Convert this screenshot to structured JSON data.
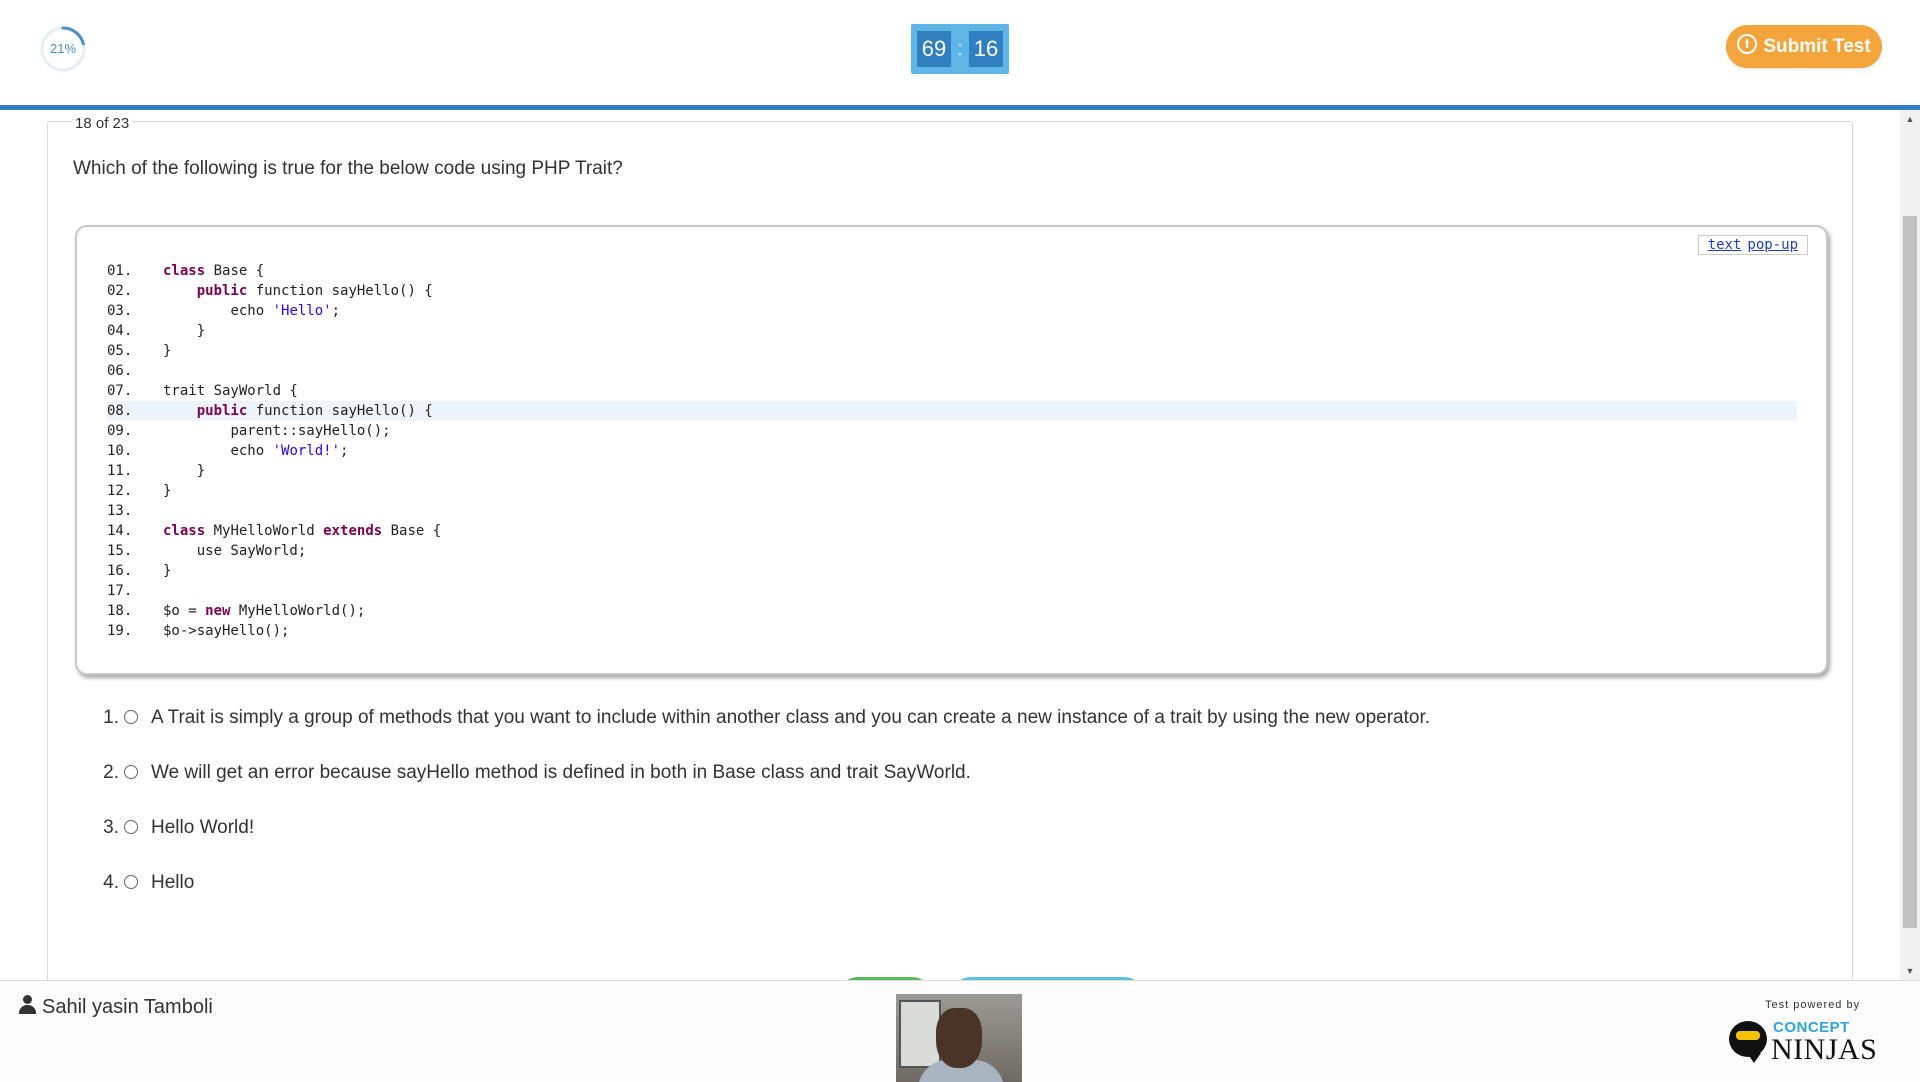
{
  "header": {
    "progress_label": "21%",
    "progress_value": 0.21,
    "timer_minutes": "69",
    "timer_separator": ":",
    "timer_seconds": "16",
    "submit_label": "Submit Test"
  },
  "question": {
    "counter": "18 of 23",
    "text": "Which of the following is true for the below code using PHP Trait?",
    "code_links": [
      "text",
      "pop-up"
    ],
    "code": [
      {
        "n": "01.",
        "indent": "",
        "tokens": [
          [
            "kw",
            "class"
          ],
          [
            "txt",
            " Base {"
          ]
        ]
      },
      {
        "n": "02.",
        "indent": "    ",
        "tokens": [
          [
            "kw",
            "public"
          ],
          [
            "txt",
            " function sayHello() {"
          ]
        ]
      },
      {
        "n": "03.",
        "indent": "        ",
        "tokens": [
          [
            "txt",
            "echo "
          ],
          [
            "str",
            "'Hello'"
          ],
          [
            "txt",
            ";"
          ]
        ]
      },
      {
        "n": "04.",
        "indent": "    ",
        "tokens": [
          [
            "txt",
            "}"
          ]
        ]
      },
      {
        "n": "05.",
        "indent": "",
        "tokens": [
          [
            "txt",
            "}"
          ]
        ]
      },
      {
        "n": "06.",
        "indent": "",
        "tokens": []
      },
      {
        "n": "07.",
        "indent": "",
        "tokens": [
          [
            "txt",
            "trait SayWorld {"
          ]
        ]
      },
      {
        "n": "08.",
        "indent": "    ",
        "tokens": [
          [
            "kw",
            "public"
          ],
          [
            "txt",
            " function sayHello() {"
          ]
        ],
        "highlight": true
      },
      {
        "n": "09.",
        "indent": "        ",
        "tokens": [
          [
            "txt",
            "parent::sayHello();"
          ]
        ]
      },
      {
        "n": "10.",
        "indent": "        ",
        "tokens": [
          [
            "txt",
            "echo "
          ],
          [
            "str",
            "'World!'"
          ],
          [
            "txt",
            ";"
          ]
        ]
      },
      {
        "n": "11.",
        "indent": "    ",
        "tokens": [
          [
            "txt",
            "}"
          ]
        ]
      },
      {
        "n": "12.",
        "indent": "",
        "tokens": [
          [
            "txt",
            "}"
          ]
        ]
      },
      {
        "n": "13.",
        "indent": "",
        "tokens": []
      },
      {
        "n": "14.",
        "indent": "",
        "tokens": [
          [
            "kw",
            "class"
          ],
          [
            "txt",
            " MyHelloWorld "
          ],
          [
            "kw",
            "extends"
          ],
          [
            "txt",
            " Base {"
          ]
        ]
      },
      {
        "n": "15.",
        "indent": "    ",
        "tokens": [
          [
            "txt",
            "use SayWorld;"
          ]
        ]
      },
      {
        "n": "16.",
        "indent": "",
        "tokens": [
          [
            "txt",
            "}"
          ]
        ]
      },
      {
        "n": "17.",
        "indent": "",
        "tokens": []
      },
      {
        "n": "18.",
        "indent": "",
        "tokens": [
          [
            "txt",
            "$o = "
          ],
          [
            "kw",
            "new"
          ],
          [
            "txt",
            " MyHelloWorld();"
          ]
        ]
      },
      {
        "n": "19.",
        "indent": "",
        "tokens": [
          [
            "txt",
            "$o->sayHello();"
          ]
        ]
      }
    ],
    "options": [
      {
        "num": "1.",
        "text": "A Trait is simply a group of methods that you want to include within another class and you can create a new instance of a trait by using the new operator."
      },
      {
        "num": "2.",
        "text": "We will get an error because sayHello method is defined in both in Base class and trait SayWorld."
      },
      {
        "num": "3.",
        "text": "Hello World!"
      },
      {
        "num": "4.",
        "text": "Hello"
      }
    ]
  },
  "footer": {
    "user_name": "Sahil yasin Tamboli",
    "powered_by": "Test powered by",
    "logo_top": "CONCEPT",
    "logo_bottom": "NINJAS"
  },
  "colors": {
    "accent": "#2f7fc1",
    "submit": "#f3a43b",
    "next": "#5cb85c",
    "review": "#5bc0de"
  }
}
